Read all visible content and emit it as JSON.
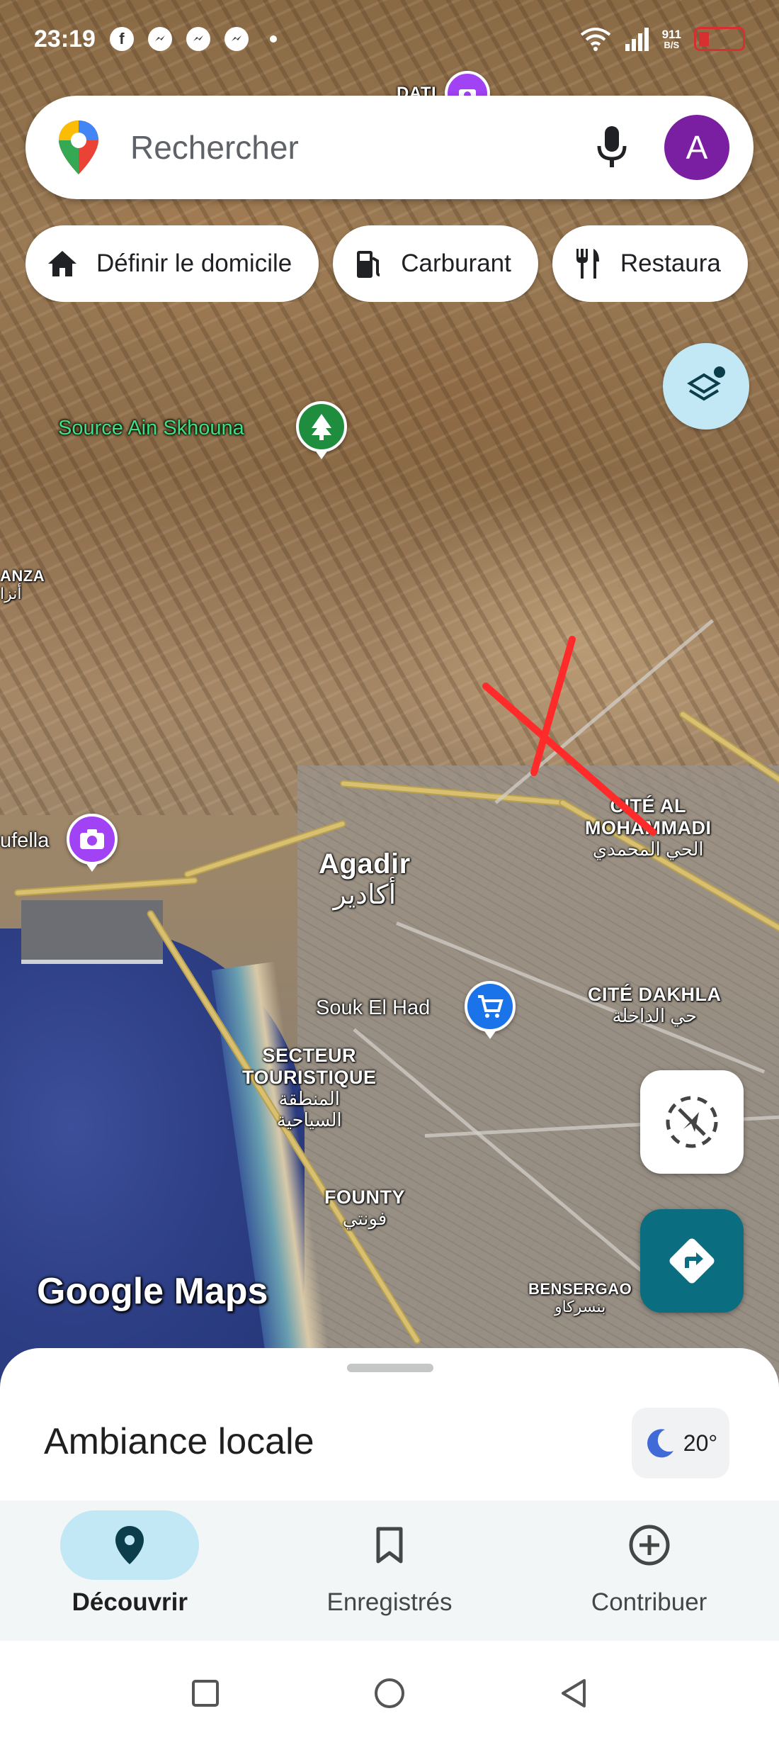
{
  "status_bar": {
    "time": "23:19",
    "notification_icons": [
      "facebook-icon",
      "messenger-icon",
      "messenger-icon",
      "messenger-icon"
    ],
    "net_speed_value": "911",
    "net_speed_unit": "B/S"
  },
  "search": {
    "placeholder": "Rechercher",
    "avatar_letter": "A"
  },
  "chips": [
    {
      "label": "Définir le domicile",
      "icon": "home-icon"
    },
    {
      "label": "Carburant",
      "icon": "gas-station-icon"
    },
    {
      "label": "Restaura",
      "icon": "restaurant-icon"
    }
  ],
  "map": {
    "labels": {
      "top_partial": "DATI",
      "source": "Source Ain Skhouna",
      "anza": "ANZA",
      "anza_ar": "أنزا",
      "taddart_partial": "ufella",
      "agadir": "Agadir",
      "agadir_ar": "أكادير",
      "cite_al_mohammadi_1": "CITÉ AL",
      "cite_al_mohammadi_2": "MOHAMMADI",
      "cite_al_mohammadi_ar": "الحي المحمدي",
      "souk": "Souk El Had",
      "cite_dakhla": "CITÉ DAKHLA",
      "cite_dakhla_ar": "حي الداخلة",
      "secteur_1": "SECTEUR",
      "secteur_2": "TOURISTIQUE",
      "secteur_ar_1": "المنطقة",
      "secteur_ar_2": "السياحية",
      "founty": "FOUNTY",
      "founty_ar": "فونتي",
      "bensergao": "BENSERGAO",
      "bensergao_ar": "بنسركاو"
    },
    "brand": "Google Maps",
    "colors": {
      "park_pin": "#1e8e3e",
      "attraction_pin": "#a142f4",
      "shopping_pin": "#1a73e8",
      "red_mark": "#ff2a2a"
    }
  },
  "sheet": {
    "title": "Ambiance locale",
    "temperature": "20°",
    "weather_icon": "moon-icon"
  },
  "bottom_nav": [
    {
      "label": "Découvrir",
      "icon": "location-pin-icon",
      "active": true
    },
    {
      "label": "Enregistrés",
      "icon": "bookmark-icon",
      "active": false
    },
    {
      "label": "Contribuer",
      "icon": "add-circle-icon",
      "active": false
    }
  ],
  "accent_color": "#0b6e80"
}
